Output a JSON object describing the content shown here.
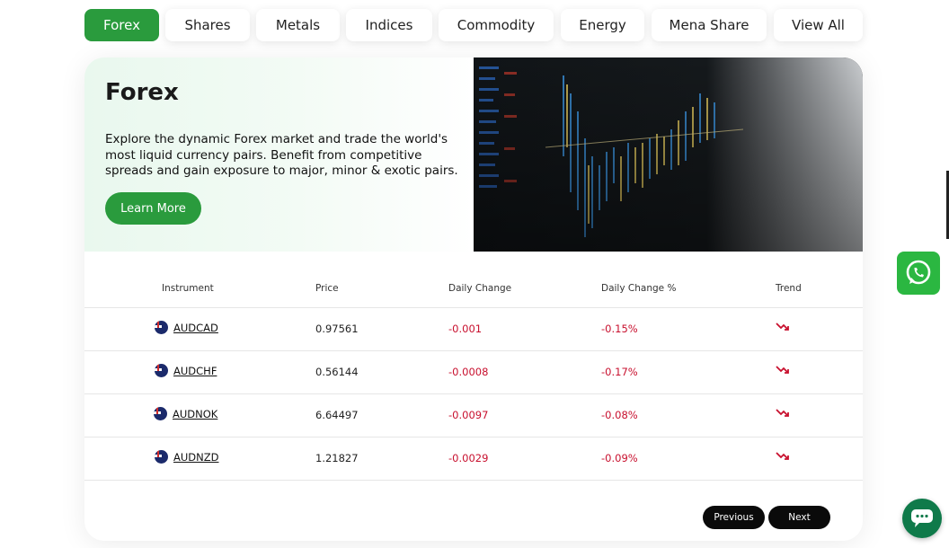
{
  "tabs": [
    {
      "label": "Forex",
      "active": true
    },
    {
      "label": "Shares",
      "active": false
    },
    {
      "label": "Metals",
      "active": false
    },
    {
      "label": "Indices",
      "active": false
    },
    {
      "label": "Commodity",
      "active": false
    },
    {
      "label": "Energy",
      "active": false
    },
    {
      "label": "Mena Share",
      "active": false
    },
    {
      "label": "View All",
      "active": false
    }
  ],
  "hero": {
    "title": "Forex",
    "description": "Explore the dynamic Forex market and trade the world's most liquid currency pairs. Benefit from competitive spreads and gain exposure to major, minor & exotic pairs.",
    "button_label": "Learn More"
  },
  "table": {
    "headers": {
      "instrument": "Instrument",
      "price": "Price",
      "daily_change": "Daily Change",
      "daily_change_pct": "Daily Change %",
      "trend": "Trend"
    },
    "rows": [
      {
        "instrument": "AUDCAD",
        "price": "0.97561",
        "daily_change": "-0.001",
        "daily_change_pct": "-0.15%",
        "trend": "down"
      },
      {
        "instrument": "AUDCHF",
        "price": "0.56144",
        "daily_change": "-0.0008",
        "daily_change_pct": "-0.17%",
        "trend": "down"
      },
      {
        "instrument": "AUDNOK",
        "price": "6.64497",
        "daily_change": "-0.0097",
        "daily_change_pct": "-0.08%",
        "trend": "down"
      },
      {
        "instrument": "AUDNZD",
        "price": "1.21827",
        "daily_change": "-0.0029",
        "daily_change_pct": "-0.09%",
        "trend": "down"
      }
    ]
  },
  "pagination": {
    "previous_label": "Previous",
    "next_label": "Next"
  },
  "colors": {
    "accent": "#2a9b3d",
    "negative": "#c8102e",
    "whatsapp": "#2bb741",
    "chat": "#0f7a4a"
  },
  "icons": {
    "whatsapp": "whatsapp-icon",
    "chat": "chat-bubble-icon",
    "trend_down": "trend-down-icon",
    "flag": "australia-flag-icon"
  }
}
